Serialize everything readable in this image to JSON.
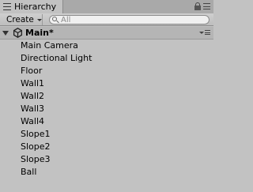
{
  "tab": {
    "title": "Hierarchy"
  },
  "toolbar": {
    "create_label": "Create",
    "search_placeholder": "All"
  },
  "scene": {
    "name": "Main*"
  },
  "objects": [
    {
      "label": "Main Camera"
    },
    {
      "label": "Directional Light"
    },
    {
      "label": "Floor"
    },
    {
      "label": "Wall1"
    },
    {
      "label": "Wall2"
    },
    {
      "label": "Wall3"
    },
    {
      "label": "Wall4"
    },
    {
      "label": "Slope1"
    },
    {
      "label": "Slope2"
    },
    {
      "label": "Slope3"
    },
    {
      "label": "Ball"
    }
  ],
  "colors": {
    "panel_bg": "#c2c2c2",
    "scene_row_bg": "#b5b5b5",
    "tabbar_bg": "#a9a9a9"
  },
  "icons": [
    "hierarchy-tab-icon",
    "lock-icon",
    "menu-icon",
    "search-icon",
    "foldout-arrow-icon",
    "unity-logo-icon",
    "scene-menu-icon"
  ]
}
